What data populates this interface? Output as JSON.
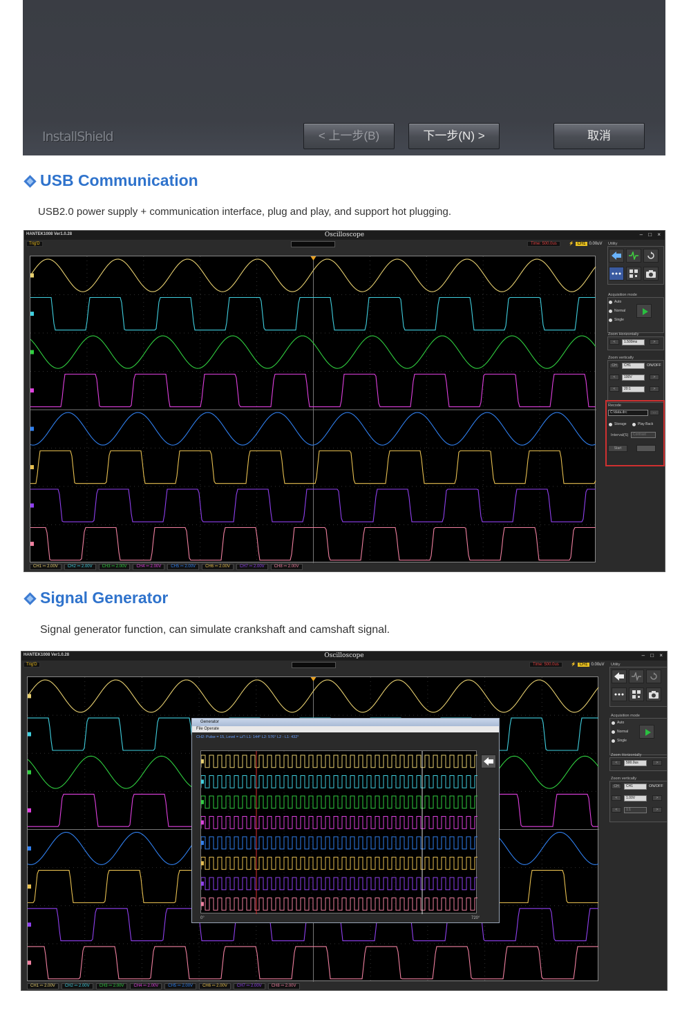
{
  "installer": {
    "logo": "InstallShield",
    "buttons": {
      "back": "< 上一步(B)",
      "next": "下一步(N) >",
      "cancel": "取消"
    }
  },
  "usb_section": {
    "title": "USB Communication",
    "description": "USB2.0 power supply + communication interface, plug and play, and support hot plugging."
  },
  "generator_section": {
    "title": "Signal Generator",
    "description": "Signal generator function, can simulate crankshaft and camshaft signal."
  },
  "scope1": {
    "version": "HANTEK1008 Ver1.0.28",
    "title": "Oscilloscope",
    "window_controls": "– □ ×",
    "trig_status": "Trig'D",
    "time": "Time: 500.0us",
    "trigger_channel": "CH1",
    "trigger_level": "0.00uV",
    "channels": [
      {
        "label": "CH1 ⎓ 2.00V",
        "color": "#e8d070"
      },
      {
        "label": "CH2 ⎓ 2.00V",
        "color": "#40d0e0"
      },
      {
        "label": "CH3 ⎓ 2.00V",
        "color": "#30d040"
      },
      {
        "label": "CH4 ⎓ 2.00V",
        "color": "#e040e0"
      },
      {
        "label": "CH5 ⎓ 2.00V",
        "color": "#3080f0"
      },
      {
        "label": "CH6 ⎓ 2.00V",
        "color": "#e8c050"
      },
      {
        "label": "CH7 ⎓ 2.00V",
        "color": "#9040f0"
      },
      {
        "label": "CH8 ⎓ 2.00V",
        "color": "#f080a0"
      }
    ],
    "side": {
      "utility": "Utility",
      "acquisition_mode": "Acquisition mode",
      "modes": [
        "Auto",
        "Normal",
        "Single"
      ],
      "zoom_horizontally": "Zoom Horizontally",
      "h_value": "1.500ms",
      "zoom_vertically": "Zoom vertically",
      "ch_value": "CH1",
      "onoff": "ON/OFF",
      "v_value": "100V",
      "probe": "20:1",
      "recode": "Recode",
      "path": "C:\\data.drc",
      "storage": "Storage",
      "playback": "Play Back",
      "interval": "Interval(S)",
      "interval_value": "Contrast",
      "start": "Start"
    }
  },
  "scope2": {
    "version": "HANTEK1008 Ver1.0.28",
    "title": "Oscilloscope",
    "window_controls": "– □ ×",
    "trig_status": "Trig'D",
    "time": "Time: 500.0us",
    "trigger_channel": "CH1",
    "trigger_level": "0.00uV",
    "side": {
      "utility": "Utility",
      "acquisition_mode": "Acquisition mode",
      "modes": [
        "Auto",
        "Normal",
        "Single"
      ],
      "zoom_horizontally": "Zoom Horizontally",
      "h_value": "500.0us",
      "zoom_vertically": "Zoom vertically",
      "ch_value": "CH1",
      "onoff": "ON/OFF",
      "v_value": "1.00V",
      "probe": "1:1"
    },
    "generator": {
      "title": "Generator",
      "menu": "File    Operate",
      "info": "CH2: Pulse = 15, Level = ⊔⊓      L1: 144°    L2: 576°    L2 - L1: 432°",
      "deg_start": "0°",
      "deg_end": "720°"
    }
  }
}
